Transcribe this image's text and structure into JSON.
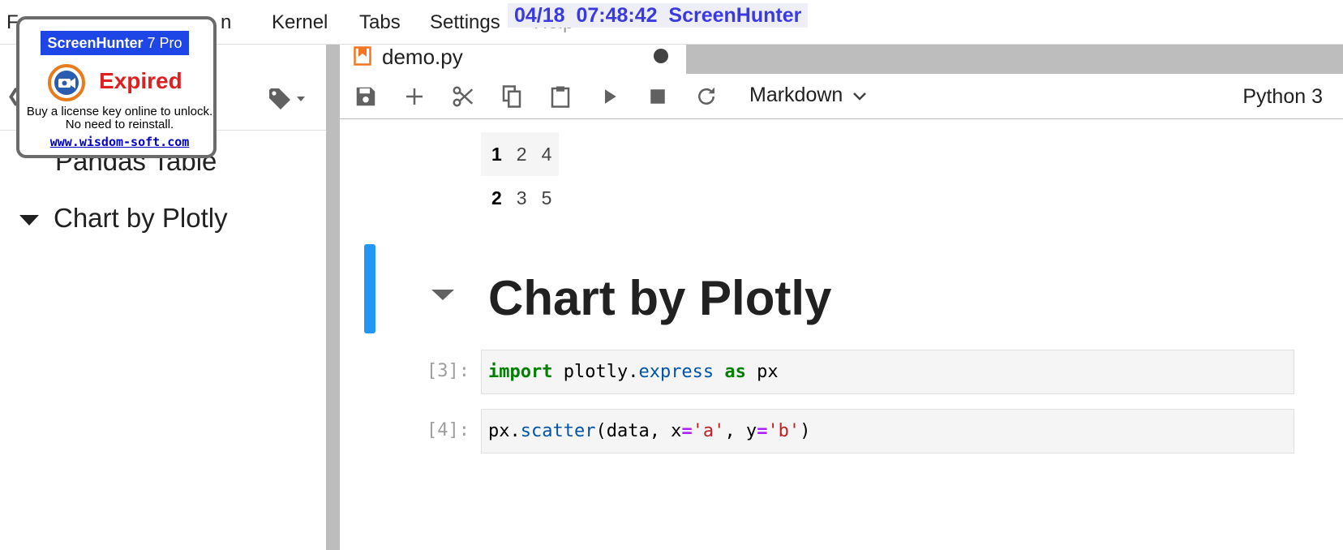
{
  "menubar": {
    "items": [
      "F",
      "n",
      "Kernel",
      "Tabs",
      "Settings",
      "Help"
    ]
  },
  "screenhunter": {
    "stamp": "04/18  07:48:42  ScreenHunter",
    "title_bold": "ScreenHunter",
    "title_rest": " 7 Pro",
    "status": "Expired",
    "message": "Buy a license key online to unlock. No need to reinstall.",
    "link": "www.wisdom-soft.com"
  },
  "left_panel": {
    "toc": [
      {
        "label": "Pandas Table"
      },
      {
        "label": "Chart by Plotly"
      }
    ]
  },
  "tab": {
    "label": "demo.py"
  },
  "toolbar": {
    "cell_type": "Markdown",
    "kernel": "Python 3",
    "icons": [
      "save-icon",
      "add-icon",
      "cut-icon",
      "copy-icon",
      "paste-icon",
      "run-icon",
      "stop-icon",
      "restart-icon"
    ]
  },
  "table": {
    "rows": [
      {
        "index": "1",
        "a": "2",
        "b": "4"
      },
      {
        "index": "2",
        "a": "3",
        "b": "5"
      }
    ]
  },
  "notebook": {
    "heading": "Chart by Plotly",
    "cells": [
      {
        "prompt": "[3]:",
        "tokens": {
          "kw1": "import",
          "mod": " plotly.",
          "attr": "express",
          "sp": " ",
          "kw2": "as",
          "alias": " px"
        }
      },
      {
        "prompt": "[4]:",
        "tokens": {
          "obj": "px.",
          "fn": "scatter",
          "open": "(data, x",
          "eq1": "=",
          "s1": "'a'",
          "mid": ", y",
          "eq2": "=",
          "s2": "'b'",
          "close": ")"
        }
      }
    ]
  },
  "colors": {
    "accent": "#2196f3",
    "watermark": "#3a3ae0",
    "expired": "#e02020"
  }
}
